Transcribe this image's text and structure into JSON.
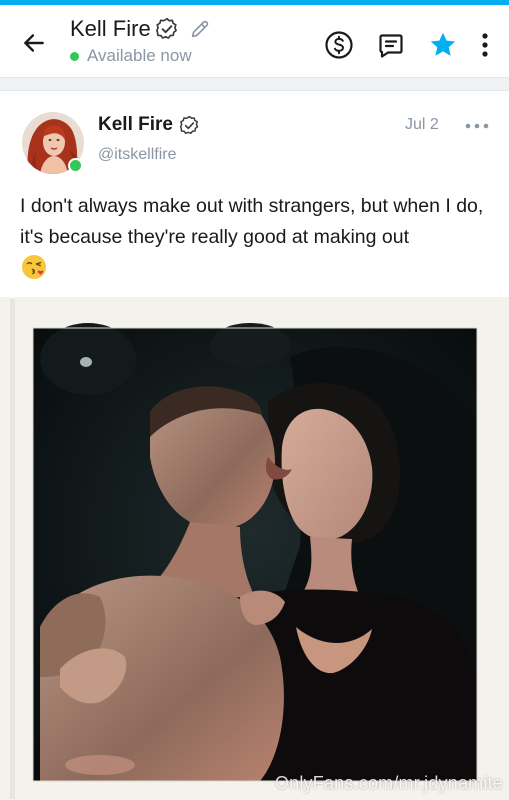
{
  "header": {
    "title": "Kell Fire",
    "status": "Available now"
  },
  "post": {
    "author_name": "Kell Fire",
    "author_handle": "@itskellfire",
    "date": "Jul 2",
    "text": "I don't always make out with strangers, but when I do, it's because they're really good at making out",
    "emoji": "kissing-face-emoji",
    "media_watermark": "OnlyFans.com/mr.jdynamite"
  },
  "colors": {
    "accent": "#00aff0",
    "online": "#34c759",
    "muted_text": "#8a96a3",
    "divider": "#e3e6ea"
  },
  "icons": {
    "back": "arrow-left-icon",
    "verified": "verified-badge-icon",
    "edit": "pencil-icon",
    "tip": "dollar-circle-icon",
    "message": "message-icon",
    "favorite": "star-icon",
    "more": "kebab-icon",
    "post_more": "more-horizontal-icon"
  }
}
